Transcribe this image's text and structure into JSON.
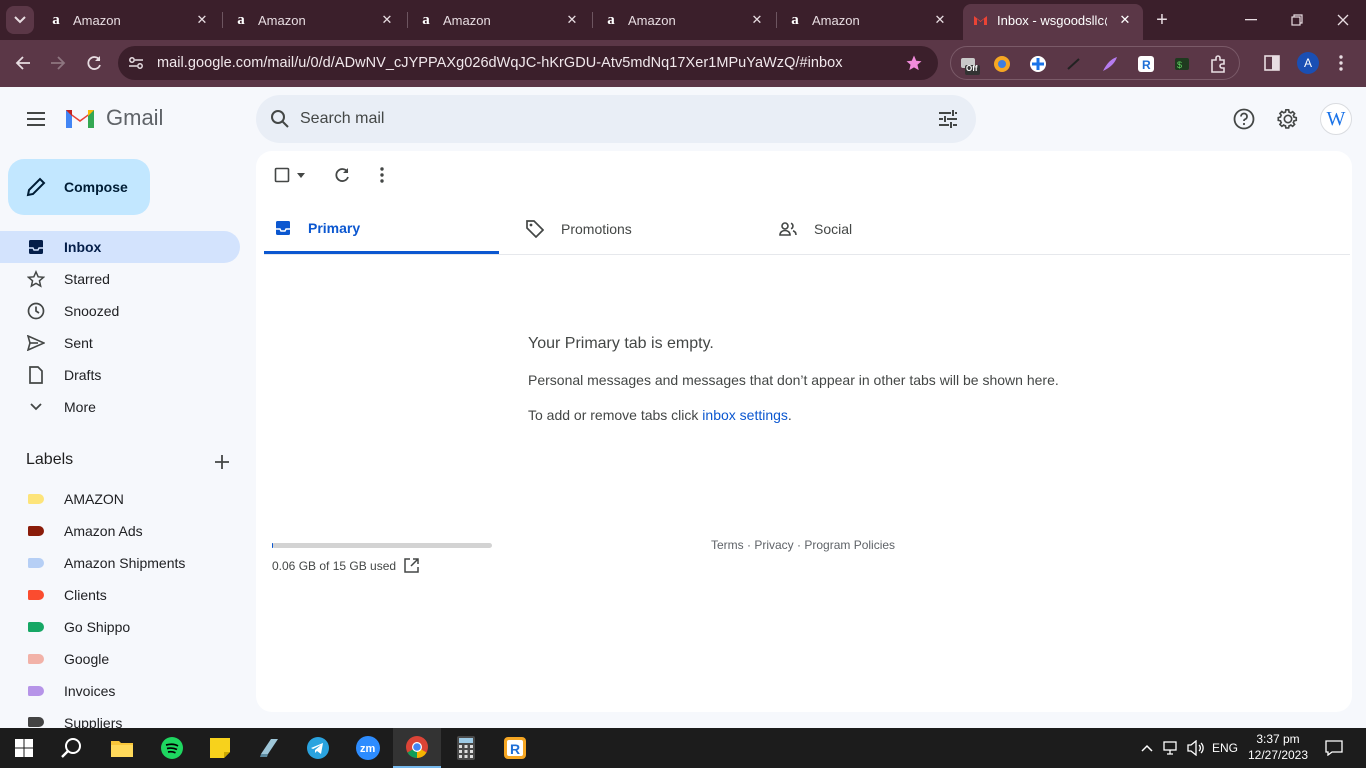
{
  "browser": {
    "tabs": [
      {
        "title": "Amazon",
        "favicon": "amazon-icon"
      },
      {
        "title": "Amazon",
        "favicon": "amazon-icon"
      },
      {
        "title": "Amazon",
        "favicon": "amazon-icon"
      },
      {
        "title": "Amazon",
        "favicon": "amazon-icon"
      },
      {
        "title": "Amazon",
        "favicon": "amazon-icon"
      },
      {
        "title": "Inbox - wsgoodsllc@",
        "favicon": "gmail-icon",
        "active": true
      }
    ],
    "url": "mail.google.com/mail/u/0/d/ADwNV_cJYPPAXg026dWqJC-hKrGDU-Atv5mdNq17Xer1MPuYaWzQ/#inbox",
    "profile_initial": "A",
    "ext_off_badge": "Off"
  },
  "gmail": {
    "logo_text": "Gmail",
    "search_placeholder": "Search mail",
    "avatar_initial": "W",
    "compose_label": "Compose",
    "nav": [
      {
        "label": "Inbox",
        "icon": "inbox-icon",
        "active": true
      },
      {
        "label": "Starred",
        "icon": "star-icon"
      },
      {
        "label": "Snoozed",
        "icon": "clock-icon"
      },
      {
        "label": "Sent",
        "icon": "send-icon"
      },
      {
        "label": "Drafts",
        "icon": "draft-icon"
      },
      {
        "label": "More",
        "icon": "chevron-down-icon"
      }
    ],
    "labels_heading": "Labels",
    "labels": [
      {
        "name": "AMAZON",
        "color": "#fde47a"
      },
      {
        "name": "Amazon Ads",
        "color": "#8a1c0a"
      },
      {
        "name": "Amazon Shipments",
        "color": "#b6cff5"
      },
      {
        "name": "Clients",
        "color": "#fb4c2f"
      },
      {
        "name": "Go Shippo",
        "color": "#16a765"
      },
      {
        "name": "Google",
        "color": "#f2b2a8"
      },
      {
        "name": "Invoices",
        "color": "#b694e8"
      },
      {
        "name": "Suppliers",
        "color": "#434343"
      }
    ],
    "tabs": [
      {
        "label": "Primary",
        "icon": "inbox-tab-icon",
        "active": true
      },
      {
        "label": "Promotions",
        "icon": "tag-icon"
      },
      {
        "label": "Social",
        "icon": "people-icon"
      }
    ],
    "empty": {
      "title": "Your Primary tab is empty.",
      "line1": "Personal messages and messages that don’t appear in other tabs will be shown here.",
      "line2_prefix": "To add or remove tabs click ",
      "line2_link": "inbox settings",
      "line2_suffix": "."
    },
    "storage": {
      "text": "0.06 GB of 15 GB used",
      "used_fraction": 0.004
    },
    "footer": {
      "terms": "Terms",
      "sep": " · ",
      "privacy": "Privacy",
      "policies": "Program Policies"
    }
  },
  "taskbar": {
    "lang": "ENG",
    "time": "3:37 pm",
    "date": "12/27/2023"
  },
  "colors": {
    "accent": "#0b57d0",
    "gmail_red": "#ea4335"
  }
}
